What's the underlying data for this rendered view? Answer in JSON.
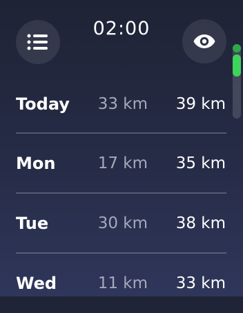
{
  "header": {
    "time": "02:00",
    "menu_icon": "list-icon",
    "view_icon": "eye-icon"
  },
  "rows": [
    {
      "day": "Today",
      "low": "33 km",
      "high": "39 km"
    },
    {
      "day": "Mon",
      "low": "17 km",
      "high": "35 km"
    },
    {
      "day": "Tue",
      "low": "30 km",
      "high": "38 km"
    },
    {
      "day": "Wed",
      "low": "11 km",
      "high": "33 km"
    }
  ],
  "colors": {
    "accent": "#3ed35a",
    "secondary_text": "#a6a9bb"
  }
}
